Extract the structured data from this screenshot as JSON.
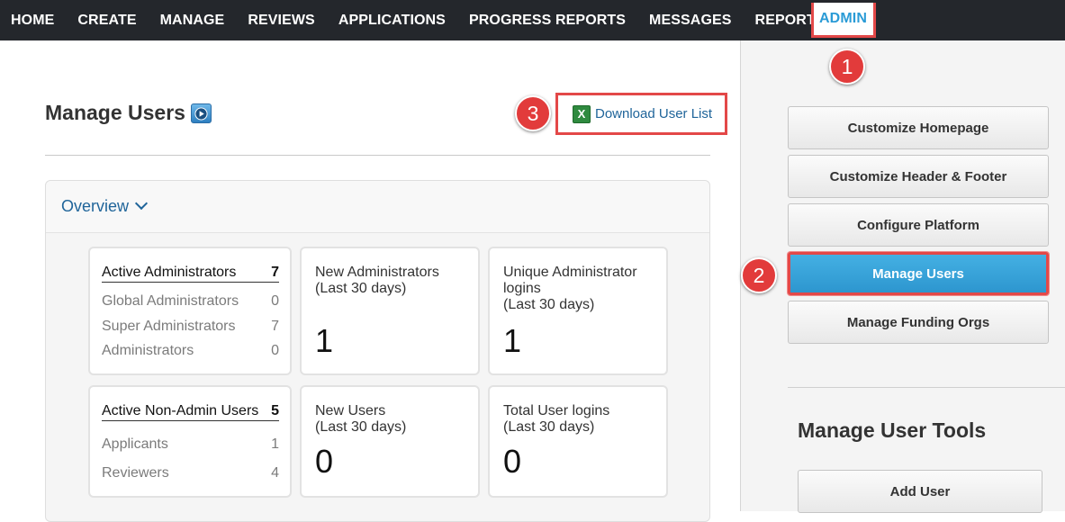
{
  "nav": {
    "items": [
      "HOME",
      "CREATE",
      "MANAGE",
      "REVIEWS",
      "APPLICATIONS",
      "PROGRESS REPORTS",
      "MESSAGES",
      "REPORTS"
    ],
    "active": "ADMIN"
  },
  "header": {
    "title": "Manage Users",
    "download_label": "Download User List",
    "excel_icon_glyph": "X"
  },
  "overview": {
    "label": "Overview",
    "admins": {
      "head_label": "Active Administrators",
      "head_value": "7",
      "rows": [
        {
          "label": "Global Administrators",
          "value": "0"
        },
        {
          "label": "Super Administrators",
          "value": "7"
        },
        {
          "label": "Administrators",
          "value": "0"
        }
      ]
    },
    "non_admins": {
      "head_label": "Active Non-Admin Users",
      "head_value": "5",
      "rows": [
        {
          "label": "Applicants",
          "value": "1"
        },
        {
          "label": "Reviewers",
          "value": "4"
        }
      ]
    },
    "new_admins": {
      "label_line1": "New Administrators",
      "label_line2": "(Last 30 days)",
      "value": "1"
    },
    "unique_logins": {
      "label_line1": "Unique Administrator",
      "label_line2": "logins",
      "label_line3": "(Last 30 days)",
      "value": "1"
    },
    "new_users": {
      "label_line1": "New Users",
      "label_line2": "(Last 30 days)",
      "value": "0"
    },
    "total_logins": {
      "label_line1": "Total User logins",
      "label_line2": "(Last 30 days)",
      "value": "0"
    }
  },
  "sidebar": {
    "buttons": [
      "Customize Homepage",
      "Customize Header & Footer",
      "Configure Platform",
      "Manage Users",
      "Manage Funding Orgs"
    ],
    "tools_title": "Manage User Tools",
    "add_user_label": "Add User"
  },
  "callouts": [
    "1",
    "2",
    "3"
  ],
  "colors": {
    "nav_bg": "#24272c",
    "accent_blue": "#2a9bd6",
    "highlight_red": "#e34848",
    "link_blue": "#20659a"
  },
  "icons": {
    "help": "play-circle-icon",
    "download": "excel-icon",
    "overview_toggle": "chevron-down-icon"
  }
}
